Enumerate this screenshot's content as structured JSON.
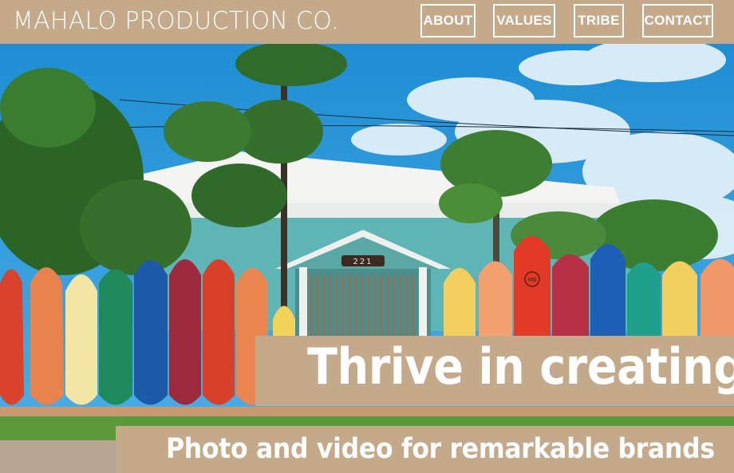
{
  "header": {
    "brand": "MAHALO PRODUCTION CO.",
    "nav": [
      {
        "label": "ABOUT"
      },
      {
        "label": "VALUES"
      },
      {
        "label": "TRIBE"
      },
      {
        "label": "CONTACT"
      }
    ]
  },
  "hero": {
    "headline": "Thrive in creating",
    "subheadline": "Photo and video for remarkable brands",
    "house_number": "221",
    "surfboard_logo": "MB"
  },
  "colors": {
    "brand_tan": "#c4a98a",
    "text_white": "#ffffff",
    "sky_blue": "#2f9ad6"
  }
}
